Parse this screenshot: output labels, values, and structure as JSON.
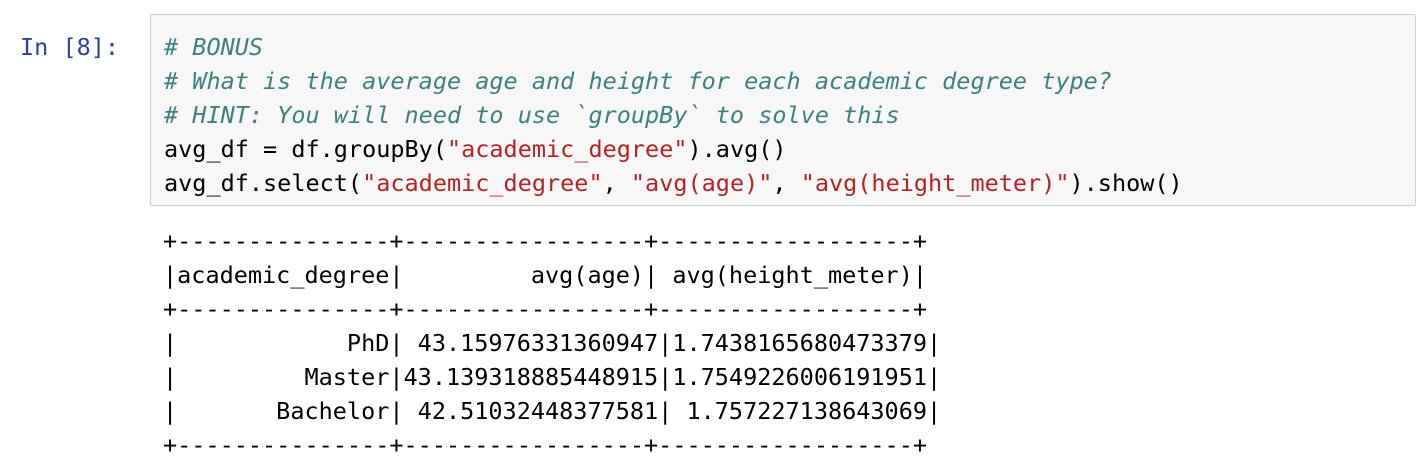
{
  "cell": {
    "prompt": "In [8]:",
    "code_lines": [
      [
        {
          "t": "# BONUS",
          "c": "cm"
        }
      ],
      [
        {
          "t": "# What is the average age and height for each academic degree type?",
          "c": "cm"
        }
      ],
      [
        {
          "t": "# HINT: You will need to use `groupBy` to solve this",
          "c": "cm"
        }
      ],
      [
        {
          "t": "avg_df = df.groupBy(",
          "c": "op"
        },
        {
          "t": "\"academic_degree\"",
          "c": "st"
        },
        {
          "t": ").avg()",
          "c": "op"
        }
      ],
      [
        {
          "t": "avg_df.select(",
          "c": "op"
        },
        {
          "t": "\"academic_degree\"",
          "c": "st"
        },
        {
          "t": ", ",
          "c": "op"
        },
        {
          "t": "\"avg(age)\"",
          "c": "st"
        },
        {
          "t": ", ",
          "c": "op"
        },
        {
          "t": "\"avg(height_meter)\"",
          "c": "st"
        },
        {
          "t": ").show()",
          "c": "op"
        }
      ]
    ]
  },
  "output": {
    "lines": [
      "+---------------+-----------------+------------------+",
      "|academic_degree|         avg(age)| avg(height_meter)|",
      "+---------------+-----------------+------------------+",
      "|            PhD| 43.15976331360947|1.7438165680473379|",
      "|         Master|43.139318885448915|1.7549226006191951|",
      "|       Bachelor| 42.51032448377581| 1.757227138643069|",
      "+---------------+-----------------+------------------+"
    ]
  },
  "colors": {
    "prompt": "#303f9f",
    "comment": "#408080",
    "string": "#ba2121",
    "input_background": "#f7f7f7",
    "input_border": "#cfcfcf"
  }
}
